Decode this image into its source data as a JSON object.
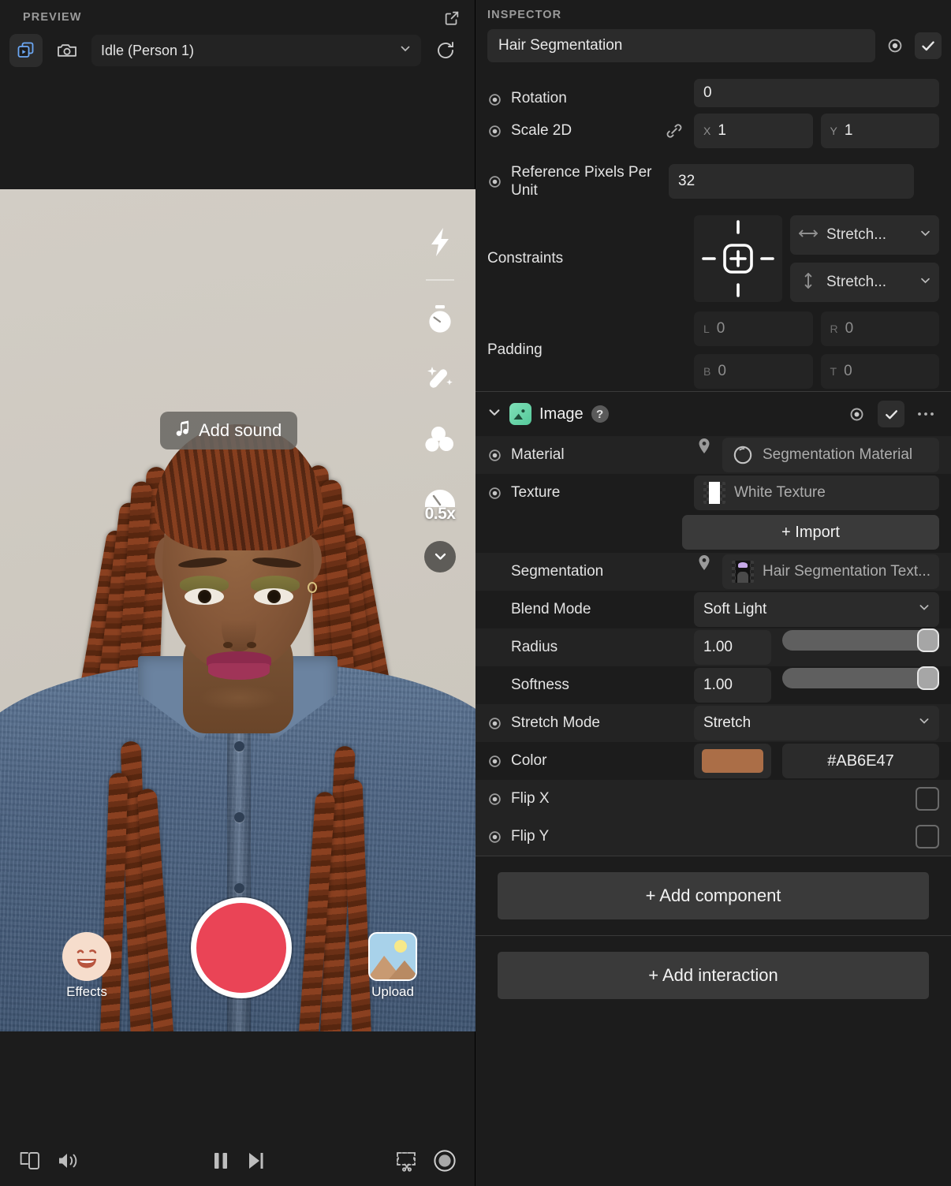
{
  "preview": {
    "panel_title": "PREVIEW",
    "open_external_icon": "open-external-icon",
    "mode_video_icon": "video-frames-icon",
    "mode_camera_icon": "camera-icon",
    "scene": {
      "value": "Idle (Person 1)",
      "chevron_icon": "chevron-down-icon"
    },
    "refresh_icon": "refresh-icon",
    "overlay": {
      "add_sound_label": "Add sound",
      "music_icon": "music-note-icon",
      "tools": [
        {
          "name": "flash-icon",
          "label": ""
        },
        {
          "name": "timer-icon",
          "label": ""
        },
        {
          "name": "magic-wand-icon",
          "label": ""
        },
        {
          "name": "filters-icon",
          "label": ""
        },
        {
          "name": "speed-icon",
          "label": "0.5x"
        }
      ],
      "collapse_icon": "chevron-down-icon",
      "effects_label": "Effects",
      "effects_icon": "winking-face-icon",
      "record_button": "record-button",
      "upload_label": "Upload",
      "upload_icon": "image-thumbnail-icon"
    },
    "footer": {
      "device_icon": "device-preview-icon",
      "volume_icon": "volume-icon",
      "pause_icon": "pause-icon",
      "step_icon": "step-forward-icon",
      "snapshot_icon": "snip-icon",
      "record_icon": "record-circle-icon"
    }
  },
  "inspector": {
    "panel_title": "INSPECTOR",
    "object_name": "Hair Segmentation",
    "target_icon": "target-icon",
    "enabled_icon": "checkmark-icon",
    "more_icon": "ellipsis-icon",
    "transform": {
      "rotation": {
        "label": "Rotation",
        "value": "0"
      },
      "scale2d": {
        "label": "Scale 2D",
        "link_icon": "link-icon",
        "x_axis": "X",
        "x_value": "1",
        "y_axis": "Y",
        "y_value": "1"
      },
      "reference_pixels": {
        "label": "Reference Pixels Per Unit",
        "value": "32"
      },
      "constraints": {
        "label": "Constraints",
        "anchor_icon": "anchor-center-icon",
        "horizontal": {
          "icon": "horizontal-arrows-icon",
          "value": "Stretch...",
          "chevron": "chevron-down-icon"
        },
        "vertical": {
          "icon": "vertical-arrows-icon",
          "value": "Stretch...",
          "chevron": "chevron-down-icon"
        }
      },
      "padding": {
        "label": "Padding",
        "left": {
          "axis": "L",
          "value": "0"
        },
        "right": {
          "axis": "R",
          "value": "0"
        },
        "bottom": {
          "axis": "B",
          "value": "0"
        },
        "top": {
          "axis": "T",
          "value": "0"
        }
      }
    },
    "image_component": {
      "title": "Image",
      "collapse_icon": "chevron-down-icon",
      "component_icon": "image-icon",
      "help_icon": "help-icon",
      "material": {
        "label": "Material",
        "pin_icon": "pin-icon",
        "asset_icon": "material-sphere-icon",
        "value": "Segmentation Material"
      },
      "texture": {
        "label": "Texture",
        "asset_icon": "checkerboard-thumb-icon",
        "value": "White Texture"
      },
      "import_label": "+ Import",
      "segmentation": {
        "label": "Segmentation",
        "pin_icon": "pin-icon",
        "asset_icon": "segmentation-thumb-icon",
        "value": "Hair Segmentation Text..."
      },
      "blend_mode": {
        "label": "Blend Mode",
        "value": "Soft Light",
        "chevron": "chevron-down-icon"
      },
      "radius": {
        "label": "Radius",
        "value": "1.00",
        "slider_pct": 100
      },
      "softness": {
        "label": "Softness",
        "value": "1.00",
        "slider_pct": 100
      },
      "stretch_mode": {
        "label": "Stretch Mode",
        "value": "Stretch",
        "chevron": "chevron-down-icon"
      },
      "color": {
        "label": "Color",
        "hex": "#AB6E47",
        "swatch": "#AB6E47"
      },
      "flip_x": {
        "label": "Flip X",
        "checked": false
      },
      "flip_y": {
        "label": "Flip Y",
        "checked": false
      }
    },
    "add_component_label": "+ Add component",
    "add_interaction_label": "+ Add interaction"
  },
  "colors": {
    "panel_bg": "#1c1c1c",
    "row_alt": "#232323",
    "field_bg": "#2b2b2b",
    "accent_blue": "#5b9bf2",
    "accent_green": "#6ed2a8",
    "record_red": "#ea4456",
    "color_value": "#AB6E47"
  }
}
